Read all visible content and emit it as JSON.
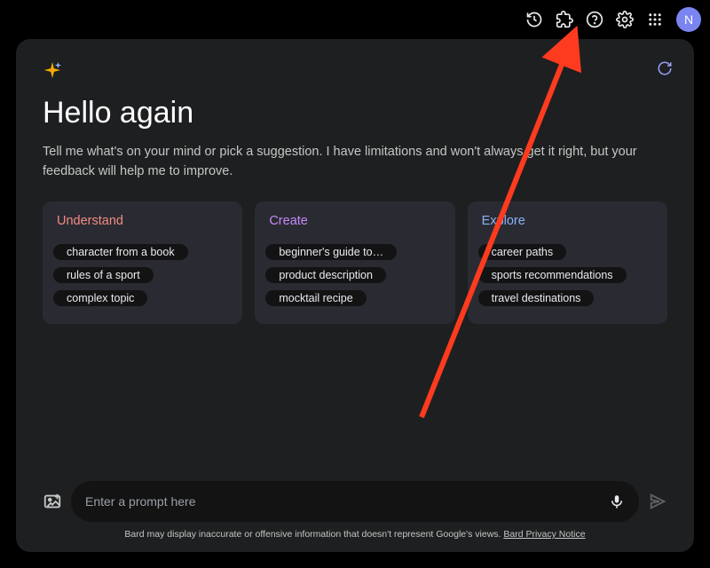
{
  "topbar": {
    "avatar_letter": "N"
  },
  "greeting": "Hello again",
  "subtitle": "Tell me what's on your mind or pick a suggestion. I have limitations and won't always get it right, but your feedback will help me to improve.",
  "cards": {
    "understand": {
      "title": "Understand",
      "chips": [
        "character from a book",
        "rules of a sport",
        "complex topic"
      ]
    },
    "create": {
      "title": "Create",
      "chips": [
        "beginner's guide to…",
        "product description",
        "mocktail recipe"
      ]
    },
    "explore": {
      "title": "Explore",
      "chips": [
        "career paths",
        "sports recommendations",
        "travel destinations"
      ]
    }
  },
  "input": {
    "placeholder": "Enter a prompt here"
  },
  "disclaimer": {
    "text": "Bard may display inaccurate or offensive information that doesn't represent Google's views. ",
    "link_label": "Bard Privacy Notice"
  },
  "colors": {
    "understand": "#f28b82",
    "create": "#c58af9",
    "explore": "#8ab4f8",
    "panel_bg": "#1e1f20",
    "card_bg": "#2a2b32",
    "chip_bg": "#131314"
  }
}
